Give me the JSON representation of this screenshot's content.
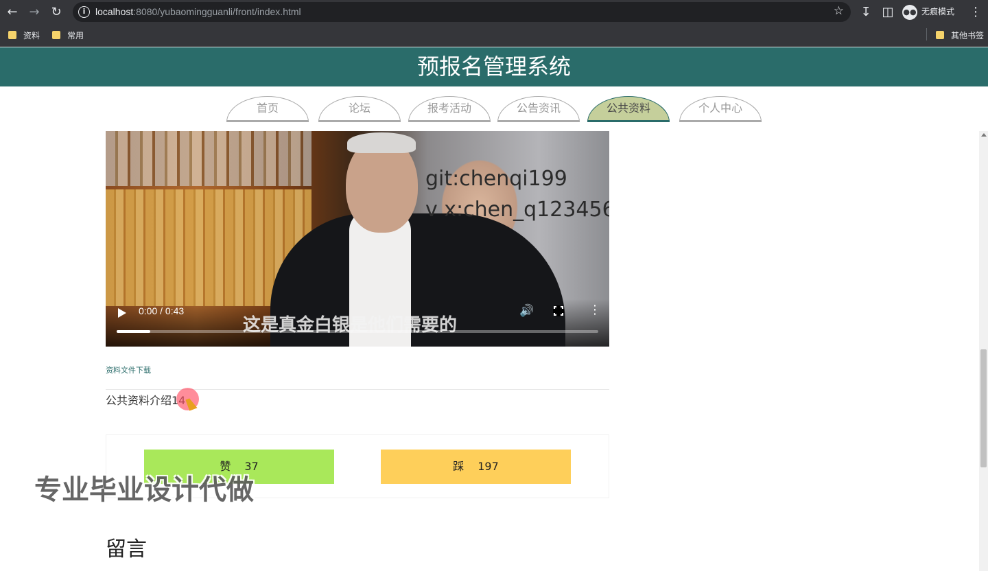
{
  "browser": {
    "url_host": "localhost",
    "url_rest": ":8080/yubaomingguanli/front/index.html",
    "bookmarks": [
      "资料",
      "常用"
    ],
    "other_bookmarks": "其他书签",
    "incognito_label": "无痕模式"
  },
  "site": {
    "title": "预报名管理系统"
  },
  "nav": {
    "tabs": [
      {
        "label": "首页"
      },
      {
        "label": "论坛"
      },
      {
        "label": "报考活动"
      },
      {
        "label": "公告资讯"
      },
      {
        "label": "公共资料",
        "active": true
      },
      {
        "label": "个人中心"
      }
    ]
  },
  "video": {
    "watermark_line1": "git:chenqi199",
    "watermark_line2": "v x:chen_q123456",
    "subtitle": "这是真金白银是他们需要的",
    "time": "0:00 / 0:43",
    "progress": 0.07
  },
  "material": {
    "download_label": "资料文件下载",
    "intro": "公共资料介绍14"
  },
  "votes": {
    "like_label": "赞",
    "like_count": "37",
    "dislike_label": "踩",
    "dislike_count": "197"
  },
  "overlay_watermark": "专业毕业设计代做",
  "comments": {
    "heading": "留言"
  }
}
